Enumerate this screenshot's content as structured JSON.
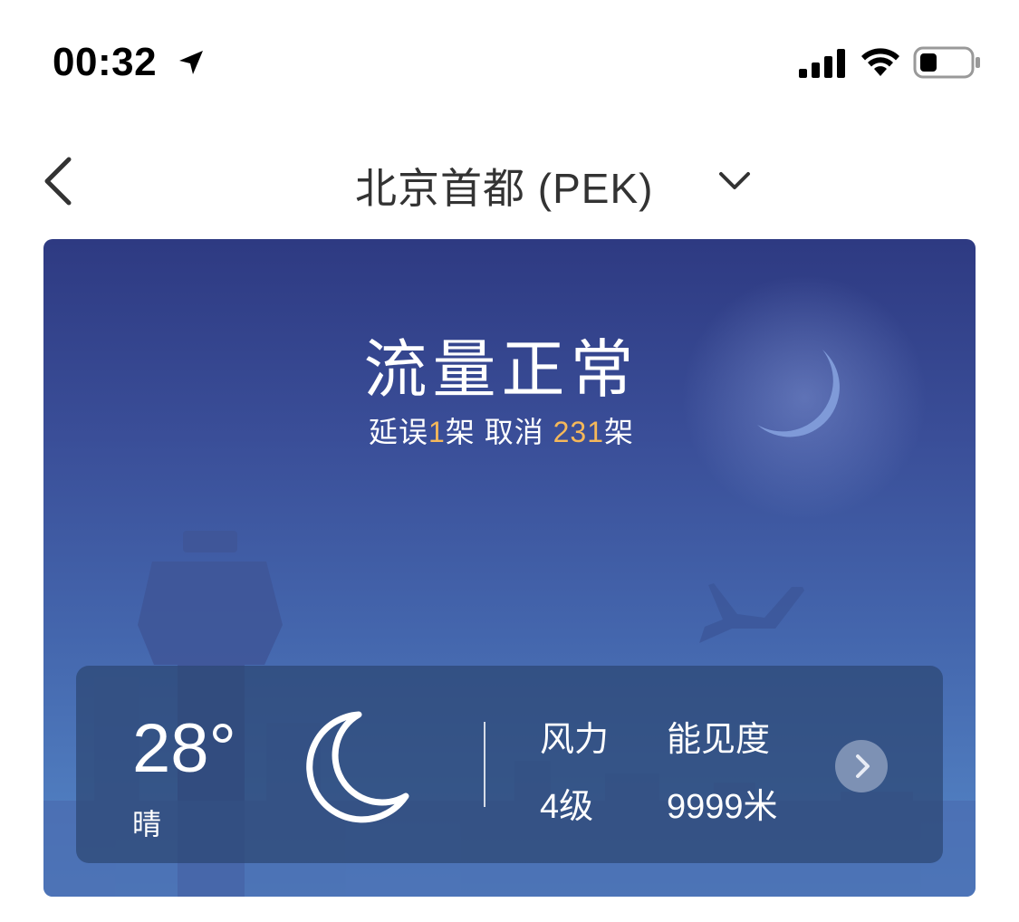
{
  "status_bar": {
    "time": "00:32",
    "icons": [
      "location-arrow-icon",
      "signal-icon",
      "wifi-icon",
      "battery-icon"
    ]
  },
  "nav": {
    "title": "北京首都 (PEK)",
    "back_icon": "chevron-left-icon",
    "dropdown_icon": "chevron-down-icon"
  },
  "airport": {
    "flow_status": "流量正常",
    "delay_label": "延误",
    "delay_count": "1",
    "delay_unit": "架",
    "cancel_label": "取消",
    "cancel_count": "231",
    "cancel_unit": "架",
    "highlight_color": "#f5b85a"
  },
  "weather": {
    "temperature": "28°",
    "condition": "晴",
    "condition_icon": "crescent-moon-icon",
    "wind_label": "风力",
    "wind_value": "4级",
    "visibility_label": "能见度",
    "visibility_value": "9999米",
    "detail_icon": "chevron-right-icon"
  }
}
